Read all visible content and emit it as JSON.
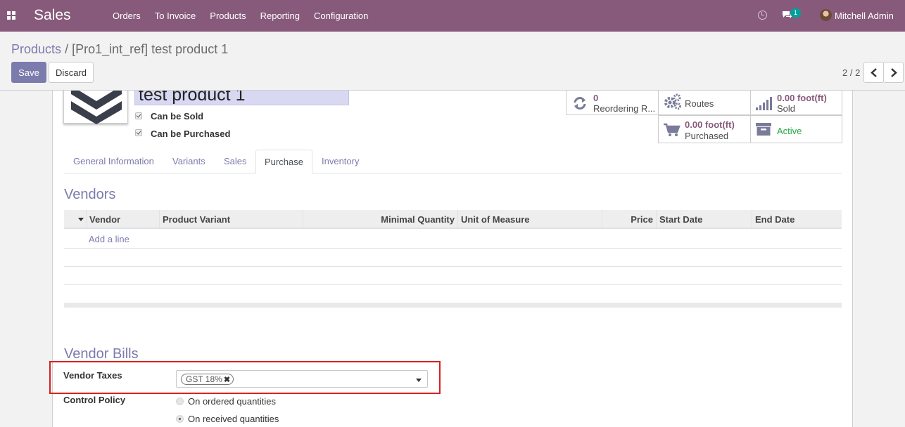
{
  "topbar": {
    "app_title": "Sales",
    "menu": [
      "Orders",
      "To Invoice",
      "Products",
      "Reporting",
      "Configuration"
    ],
    "chat_badge": "1",
    "user_name": "Mitchell Admin"
  },
  "control": {
    "breadcrumb_parent": "Products",
    "breadcrumb_separator": "/",
    "breadcrumb_current": "[Pro1_int_ref] test product 1",
    "save_label": "Save",
    "discard_label": "Discard",
    "pager": "2 / 2"
  },
  "product": {
    "name": "test product 1",
    "can_be_sold": "Can be Sold",
    "can_be_purchased": "Can be Purchased"
  },
  "smart_buttons": {
    "reordering_value": "0",
    "reordering_label": "Reordering R...",
    "routes_label": "Routes",
    "sold_value": "0.00",
    "sold_unit": "foot(ft)",
    "sold_label": "Sold",
    "purchased_value": "0.00",
    "purchased_unit": "foot(ft)",
    "purchased_label": "Purchased",
    "active_label": "Active"
  },
  "tabs": [
    "General Information",
    "Variants",
    "Sales",
    "Purchase",
    "Inventory"
  ],
  "active_tab": "Purchase",
  "vendors": {
    "title": "Vendors",
    "columns": [
      "Vendor",
      "Product Variant",
      "Minimal Quantity",
      "Unit of Measure",
      "Price",
      "Start Date",
      "End Date"
    ],
    "add_line": "Add a line"
  },
  "vendor_bills": {
    "title": "Vendor Bills",
    "vendor_taxes_label": "Vendor Taxes",
    "tax_tag": "GST 18%",
    "control_policy_label": "Control Policy",
    "policy_options": [
      "On ordered quantities",
      "On received quantities"
    ],
    "policy_selected": "On received quantities"
  },
  "colors": {
    "brand": "#875a7b",
    "accent": "#7c7bad",
    "active_green": "#28a745",
    "highlight": "#d9201f"
  }
}
